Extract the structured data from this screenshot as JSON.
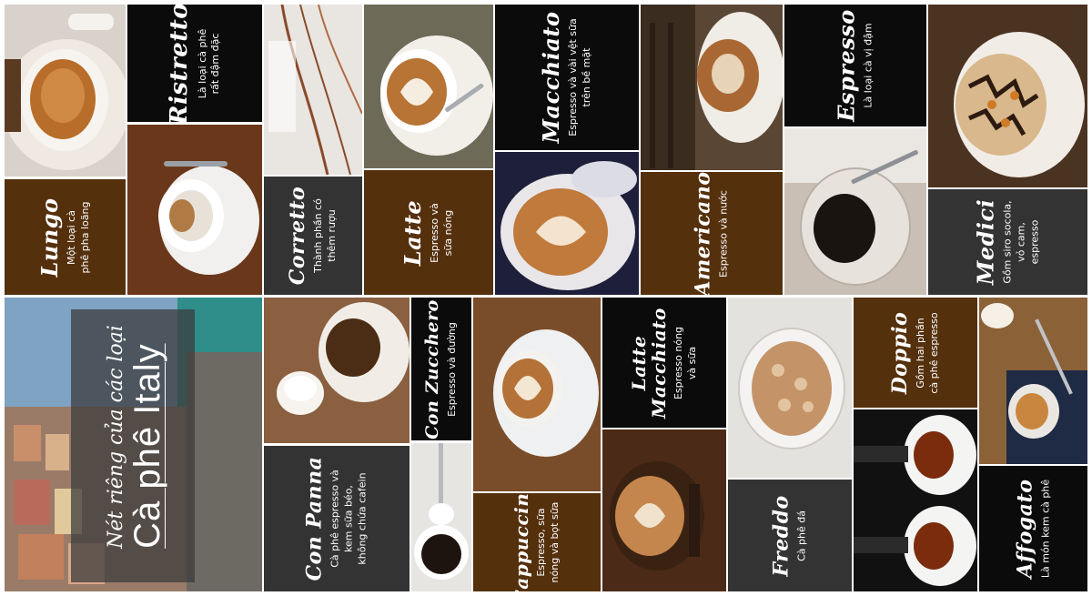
{
  "hero": {
    "subtitle": "Nét riêng của các loại",
    "title": "Cà phê Italy"
  },
  "coffees": {
    "ristretto": {
      "name": "Ristretto",
      "desc": "Là loại cà phê\nrất đậm đặc"
    },
    "lungo": {
      "name": "Lungo",
      "desc": "Một loại cà\nphê pha loãng"
    },
    "corretto": {
      "name": "Corretto",
      "desc": "Thành phần có\nthêm rượu"
    },
    "latte": {
      "name": "Latte",
      "desc": "Espresso và sữa nóng"
    },
    "macchiato": {
      "name": "Macchiato",
      "desc": "Espresso và vài vệt sữa\ntrên bề mặt"
    },
    "americano": {
      "name": "Americano",
      "desc": "Espresso và nước"
    },
    "espresso": {
      "name": "Espresso",
      "desc": "Là loại cà vị đậm"
    },
    "medici": {
      "name": "Medici",
      "desc": "Gồm siro socola,\nvỏ cam, espresso"
    },
    "con_zucchero": {
      "name": "Con Zucchero",
      "desc": "Espresso và đường"
    },
    "con_panna": {
      "name": "Con Panna",
      "desc": "Cà phê espresso và\nkem sữa béo,\nkhông chứa cafein"
    },
    "cappuccino": {
      "name": "Cappuccino",
      "desc": "Espresso, sữa\nnóng và bọt sữa"
    },
    "latte_macchiato": {
      "name": "Latte\nMacchiato",
      "desc": "Espresso nóng\nvà sữa"
    },
    "freddo": {
      "name": "Freddo",
      "desc": "Cà phê đá"
    },
    "doppio": {
      "name": "Doppio",
      "desc": "Gồm hai phần\ncà phê espresso"
    },
    "affogato": {
      "name": "Affogato",
      "desc": "Là món kem cà phê"
    }
  },
  "colors": {
    "black_panel": "#0b0b0b",
    "brown_panel": "#55300d",
    "gray_panel": "#333333",
    "coffee": "#8a5524",
    "cup": "#f3efe9"
  }
}
